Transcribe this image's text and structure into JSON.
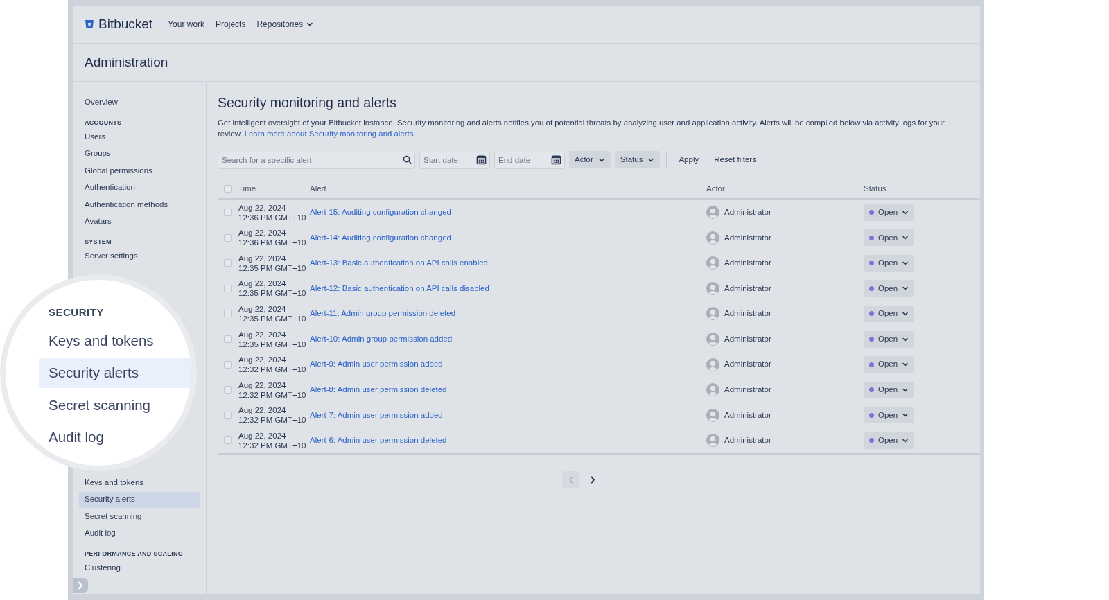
{
  "header": {
    "logo": "Bitbucket",
    "nav": [
      {
        "label": "Your work",
        "dropdown": false
      },
      {
        "label": "Projects",
        "dropdown": false
      },
      {
        "label": "Repositories",
        "dropdown": true
      }
    ]
  },
  "admin_title": "Administration",
  "sidebar": {
    "sections": [
      {
        "items": [
          {
            "label": "Overview",
            "selected": false
          }
        ]
      },
      {
        "heading": "ACCOUNTS",
        "items": [
          {
            "label": "Users",
            "selected": false
          },
          {
            "label": "Groups",
            "selected": false
          },
          {
            "label": "Global permissions",
            "selected": false
          },
          {
            "label": "Authentication",
            "selected": false
          },
          {
            "label": "Authentication methods",
            "selected": false
          },
          {
            "label": "Avatars",
            "selected": false
          }
        ]
      },
      {
        "heading": "SYSTEM",
        "items": [
          {
            "label": "Server settings",
            "selected": false
          }
        ]
      },
      {
        "items": [
          {
            "label": "Keys and tokens",
            "selected": false
          },
          {
            "label": "Security alerts",
            "selected": true
          },
          {
            "label": "Secret scanning",
            "selected": false
          },
          {
            "label": "Audit log",
            "selected": false
          }
        ]
      },
      {
        "heading": "PERFORMANCE AND SCALING",
        "items": [
          {
            "label": "Clustering",
            "selected": false
          }
        ]
      }
    ]
  },
  "magnifier": {
    "heading": "SECURITY",
    "items": [
      {
        "label": "Keys and tokens",
        "selected": false
      },
      {
        "label": "Security alerts",
        "selected": true
      },
      {
        "label": "Secret scanning",
        "selected": false
      },
      {
        "label": "Audit log",
        "selected": false
      }
    ]
  },
  "page": {
    "title": "Security monitoring and alerts",
    "description": "Get intelligent oversight of your Bitbucket instance. Security monitoring and alerts notifies you of potential threats by analyzing user and application activity. Alerts will be compiled below via activity logs for your review.",
    "link": "Learn more about Security monitoring and alerts",
    "link_after": "."
  },
  "filters": {
    "search_placeholder": "Search for a specific alert",
    "start_placeholder": "Start date",
    "end_placeholder": "End date",
    "dropdowns": [
      "Actor",
      "Status"
    ],
    "apply": "Apply",
    "reset": "Reset filters"
  },
  "table": {
    "columns": [
      "Time",
      "Alert",
      "Actor",
      "Status"
    ],
    "all_checked": false,
    "rows": [
      {
        "checked": false,
        "date": "Aug 22, 2024",
        "time": "12:36 PM GMT+10",
        "alert": "Alert-15: Auditing configuration changed",
        "actor": "Administrator",
        "status": "Open"
      },
      {
        "checked": false,
        "date": "Aug 22, 2024",
        "time": "12:36 PM GMT+10",
        "alert": "Alert-14: Auditing configuration changed",
        "actor": "Administrator",
        "status": "Open"
      },
      {
        "checked": false,
        "date": "Aug 22, 2024",
        "time": "12:35 PM GMT+10",
        "alert": "Alert-13: Basic authentication on API calls enabled",
        "actor": "Administrator",
        "status": "Open"
      },
      {
        "checked": false,
        "date": "Aug 22, 2024",
        "time": "12:35 PM GMT+10",
        "alert": "Alert-12: Basic authentication on API calls disabled",
        "actor": "Administrator",
        "status": "Open"
      },
      {
        "checked": false,
        "date": "Aug 22, 2024",
        "time": "12:35 PM GMT+10",
        "alert": "Alert-11: Admin group permission deleted",
        "actor": "Administrator",
        "status": "Open"
      },
      {
        "checked": false,
        "date": "Aug 22, 2024",
        "time": "12:35 PM GMT+10",
        "alert": "Alert-10: Admin group permission added",
        "actor": "Administrator",
        "status": "Open"
      },
      {
        "checked": false,
        "date": "Aug 22, 2024",
        "time": "12:32 PM GMT+10",
        "alert": "Alert-9: Admin user permission added",
        "actor": "Administrator",
        "status": "Open"
      },
      {
        "checked": false,
        "date": "Aug 22, 2024",
        "time": "12:32 PM GMT+10",
        "alert": "Alert-8: Admin user permission deleted",
        "actor": "Administrator",
        "status": "Open"
      },
      {
        "checked": false,
        "date": "Aug 22, 2024",
        "time": "12:32 PM GMT+10",
        "alert": "Alert-7: Admin user permission added",
        "actor": "Administrator",
        "status": "Open"
      },
      {
        "checked": false,
        "date": "Aug 22, 2024",
        "time": "12:32 PM GMT+10",
        "alert": "Alert-6: Admin user permission deleted",
        "actor": "Administrator",
        "status": "Open"
      }
    ]
  },
  "pagination": {
    "prev_disabled": true,
    "next_disabled": false
  }
}
